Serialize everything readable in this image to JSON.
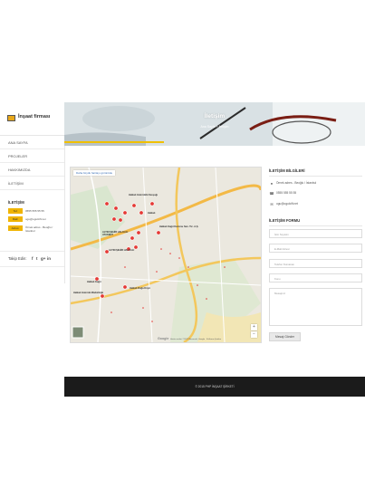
{
  "brand": {
    "name": "İnşaat firması",
    "icon": "building-icon"
  },
  "nav": [
    {
      "label": "ANA SAYFA"
    },
    {
      "label": "PROJELER"
    },
    {
      "label": "HAKKIMIZDA"
    },
    {
      "label": "İLETİŞİM"
    }
  ],
  "sidebar_contact": {
    "title": "İLETİŞİM",
    "rows": [
      {
        "tag": "Tel:",
        "value": "0555 555 55 55"
      },
      {
        "tag": "Mail:",
        "value": "ogu@ogulcift.net"
      },
      {
        "tag": "Adres:",
        "value": "Örnek adres - Beoğlu / İstanbul"
      }
    ]
  },
  "social": {
    "label": "Takip Edin:",
    "icons": [
      "f",
      "t",
      "g+",
      "in"
    ]
  },
  "hero": {
    "title": "İletişim",
    "breadcrumb": "Ana Sayfa » İletişim"
  },
  "map": {
    "link_text": "Daha büyük haritayı görüntüle",
    "labels": [
      "Halkalı Gümrüklü Kavşağı",
      "Halkalı",
      "ALTIN ŞEHİR HALKALI ATAKENT",
      "ALTIN ŞEHİR HALKALI",
      "Halkalı Kağıt Kartonu San. Tic. A.Ş.",
      "Halkalı Kağıt",
      "Halkalı Doğa Köyü",
      "Halkalı Gümrük Müdürlüğü"
    ],
    "footer": "Harita verileri ©2017 Basarsoft, Google · Kullanım Şartları",
    "logo": "Google"
  },
  "contact_info": {
    "title": "İLETİŞİM BİLGİLERİ",
    "address": "Örnek adres - Beoğlu / İstanbul",
    "phone": "0555 555 55 55",
    "email": "ogu@ogulcift.net"
  },
  "form": {
    "title": "İLETİŞİM FORMU",
    "name_placeholder": "İsim Soyisim",
    "email_placeholder": "E-Mail Adresi",
    "phone_placeholder": "Telefon Numarası",
    "subject_placeholder": "Konu",
    "message_placeholder": "Mesajınız",
    "submit_label": "Mesajı Gönder"
  },
  "footer": {
    "text": "© 2015 PHP İNŞAAT ŞİRKETİ"
  }
}
